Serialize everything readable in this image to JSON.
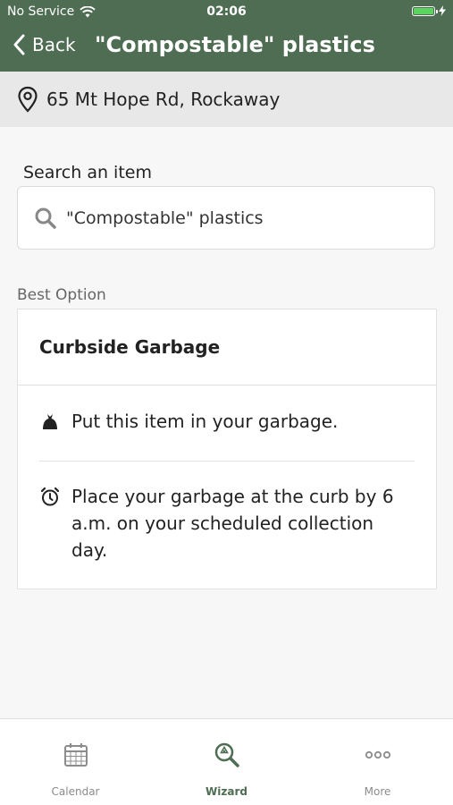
{
  "status_bar": {
    "carrier": "No Service",
    "time": "02:06"
  },
  "nav": {
    "back_label": "Back",
    "title": "\"Compostable\" plastics"
  },
  "address": {
    "text": "65 Mt Hope Rd, Rockaway"
  },
  "search": {
    "label": "Search an item",
    "value": "\"Compostable\" plastics"
  },
  "result": {
    "section_label": "Best Option",
    "title": "Curbside Garbage",
    "steps": [
      {
        "icon": "garbage-bag-icon",
        "text": "Put this item in your garbage."
      },
      {
        "icon": "alarm-clock-icon",
        "text": "Place your garbage at the curb by 6 a.m. on your scheduled collection day."
      }
    ]
  },
  "tabs": [
    {
      "label": "Calendar",
      "icon": "calendar-icon",
      "active": false
    },
    {
      "label": "Wizard",
      "icon": "wizard-search-icon",
      "active": true
    },
    {
      "label": "More",
      "icon": "more-icon",
      "active": false
    }
  ],
  "colors": {
    "header": "#4e6d53",
    "battery": "#5bd35f"
  }
}
